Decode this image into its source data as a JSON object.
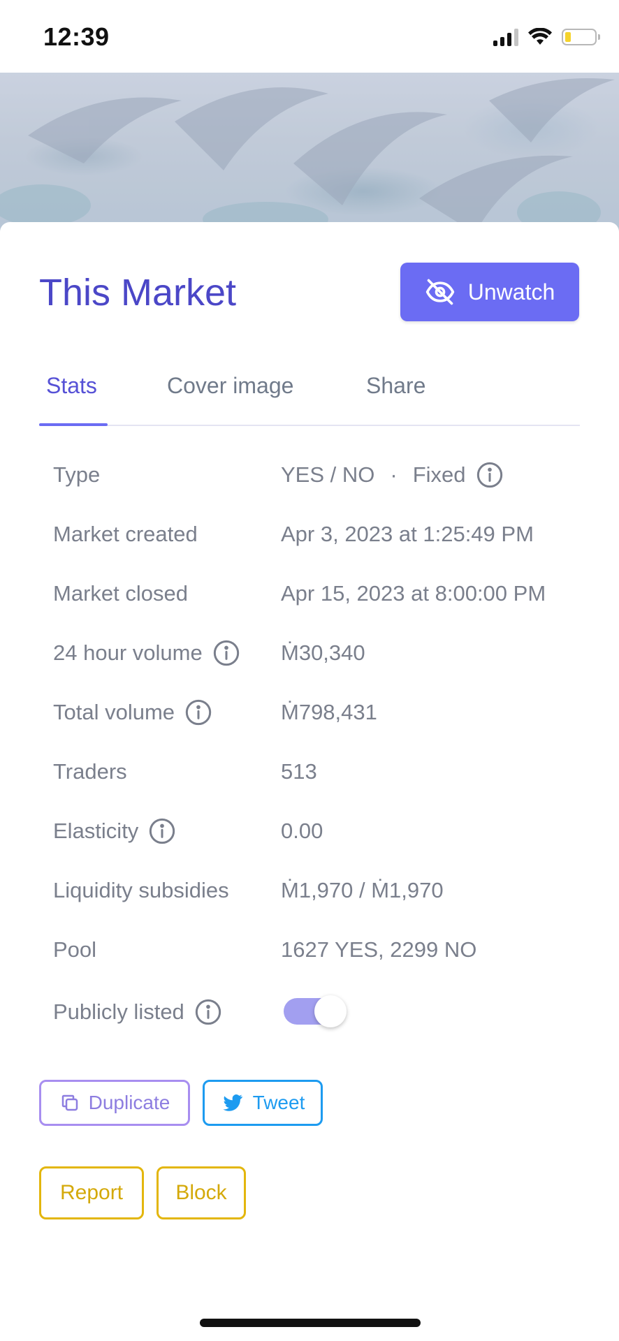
{
  "status_bar": {
    "time": "12:39"
  },
  "market": {
    "title": "This Market"
  },
  "header": {
    "unwatch_label": "Unwatch"
  },
  "tabs": [
    {
      "label": "Stats",
      "active": true
    },
    {
      "label": "Cover image",
      "active": false
    },
    {
      "label": "Share",
      "active": false
    }
  ],
  "stats": {
    "type": {
      "label": "Type",
      "value_kind": "YES / NO",
      "value_sep": "·",
      "value_mode": "Fixed"
    },
    "market_created": {
      "label": "Market created",
      "value": "Apr 3, 2023 at 1:25:49 PM"
    },
    "market_closed": {
      "label": "Market closed",
      "value": "Apr 15, 2023 at 8:00:00 PM"
    },
    "volume_24h": {
      "label": "24 hour volume",
      "value": "Ṁ30,340"
    },
    "total_volume": {
      "label": "Total volume",
      "value": "Ṁ798,431"
    },
    "traders": {
      "label": "Traders",
      "value": "513"
    },
    "elasticity": {
      "label": "Elasticity",
      "value": "0.00"
    },
    "liquidity": {
      "label": "Liquidity subsidies",
      "value": "Ṁ1,970 / Ṁ1,970"
    },
    "pool": {
      "label": "Pool",
      "value": "1627 YES, 2299 NO"
    },
    "publicly_listed": {
      "label": "Publicly listed",
      "enabled": true
    }
  },
  "actions": {
    "duplicate_label": "Duplicate",
    "tweet_label": "Tweet",
    "report_label": "Report",
    "block_label": "Block"
  },
  "colors": {
    "accent": "#6b6cf3",
    "title": "#4b47c7",
    "twitter": "#1d9bf0",
    "warning": "#e3b60d"
  }
}
